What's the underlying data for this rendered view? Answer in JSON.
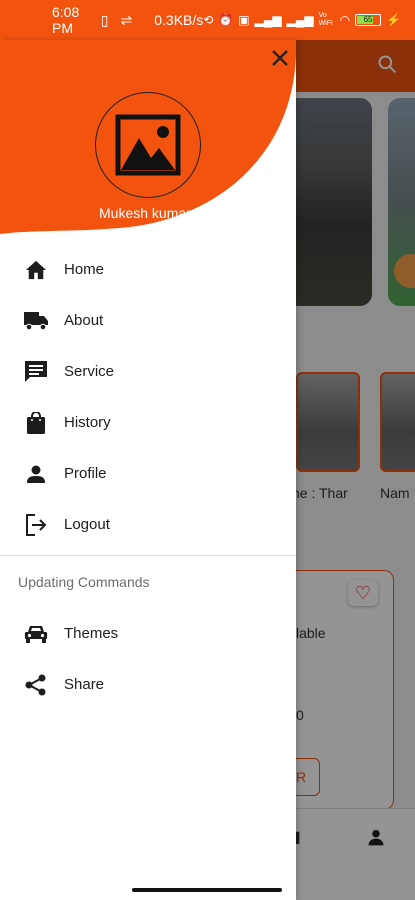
{
  "status_bar": {
    "time": "6:08 PM",
    "net_speed": "0.3KB/s",
    "battery": "65",
    "volte": "Vo WiFi"
  },
  "drawer": {
    "user_name": "Mukesh kumar",
    "menu_items": [
      {
        "label": "Home",
        "icon": "home-icon"
      },
      {
        "label": "About",
        "icon": "truck-icon"
      },
      {
        "label": "Service",
        "icon": "message-icon"
      },
      {
        "label": "History",
        "icon": "shopping-bag-icon"
      },
      {
        "label": "Profile",
        "icon": "person-icon"
      },
      {
        "label": "Logout",
        "icon": "logout-icon"
      }
    ],
    "section_title": "Updating Commands",
    "section_items": [
      {
        "label": "Themes",
        "icon": "car-icon"
      },
      {
        "label": "Share",
        "icon": "share-icon"
      }
    ]
  },
  "background": {
    "thumb_label_1": "ne : Thar",
    "thumb_label_2": "Nam",
    "availability_text": "lable",
    "price_text": "0",
    "button_text": "R"
  },
  "colors": {
    "accent": "#f25410",
    "scrim": "rgba(0,0,0,0.42)"
  }
}
